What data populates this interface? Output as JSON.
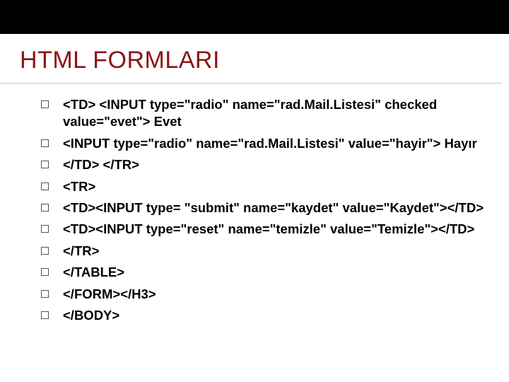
{
  "heading": "HTML FORMLARI",
  "items": [
    "<TD> <INPUT type=\"radio\" name=\"rad.Mail.Listesi\" checked value=\"evet\"> Evet",
    "<INPUT type=\"radio\" name=\"rad.Mail.Listesi\" value=\"hayir\"> Hayır",
    "</TD> </TR>",
    "<TR>",
    "<TD><INPUT type= \"submit\" name=\"kaydet\" value=\"Kaydet\"></TD>",
    "<TD><INPUT type=\"reset\" name=\"temizle\" value=\"Temizle\"></TD>",
    "</TR>",
    "</TABLE>",
    "</FORM></H3>",
    "</BODY>"
  ]
}
